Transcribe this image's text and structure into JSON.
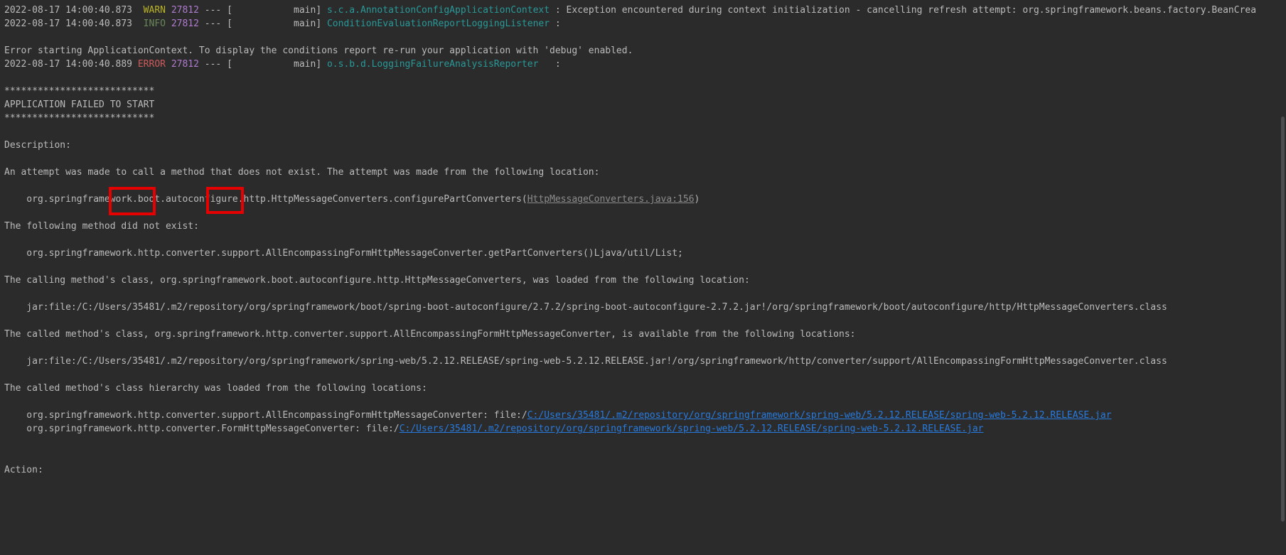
{
  "log_lines": [
    {
      "ts": "2022-08-17 14:00:40.873",
      "level": "WARN",
      "pid": "27812",
      "sep": "--- [           main]",
      "logger": "s.c.a.AnnotationConfigApplicationContext",
      "message": " : Exception encountered during context initialization - cancelling refresh attempt: org.springframework.beans.factory.BeanCrea"
    },
    {
      "ts": "2022-08-17 14:00:40.873",
      "level": "INFO",
      "pid": "27812",
      "sep": "--- [           main]",
      "logger": "ConditionEvaluationReportLoggingListener",
      "message": " :"
    },
    {
      "ts": "2022-08-17 14:00:40.889",
      "level": "ERROR",
      "pid": "27812",
      "sep": "--- [           main]",
      "logger": "o.s.b.d.LoggingFailureAnalysisReporter",
      "message": "   :"
    }
  ],
  "text": {
    "error_starting": "Error starting ApplicationContext. To display the conditions report re-run your application with 'debug' enabled.",
    "stars1": "***************************",
    "failed_title": "APPLICATION FAILED TO START",
    "stars2": "***************************",
    "description": "Description:",
    "attempt": "An attempt was made to call a method that does not exist. The attempt was made from the following location:",
    "location_prefix": "    org.springframework.boot.autoconfigure.http.HttpMessageConverters.configurePartConverters(",
    "location_link": "HttpMessageConverters.java:156",
    "location_suffix": ")",
    "not_exist": "The following method did not exist:",
    "method": "    org.springframework.http.converter.support.AllEncompassingFormHttpMessageConverter.getPartConverters()Ljava/util/List;",
    "calling_class": "The calling method's class, org.springframework.boot.autoconfigure.http.HttpMessageConverters, was loaded from the following location:",
    "calling_jar": "    jar:file:/C:/Users/35481/.m2/repository/org/springframework/boot/spring-boot-autoconfigure/2.7.2/spring-boot-autoconfigure-2.7.2.jar!/org/springframework/boot/autoconfigure/http/HttpMessageConverters.class",
    "called_class": "The called method's class, org.springframework.http.converter.support.AllEncompassingFormHttpMessageConverter, is available from the following locations:",
    "called_jar": "    jar:file:/C:/Users/35481/.m2/repository/org/springframework/spring-web/5.2.12.RELEASE/spring-web-5.2.12.RELEASE.jar!/org/springframework/http/converter/support/AllEncompassingFormHttpMessageConverter.class",
    "hierarchy": "The called method's class hierarchy was loaded from the following locations:",
    "hier1_prefix": "    org.springframework.http.converter.support.AllEncompassingFormHttpMessageConverter: file:/",
    "hier1_link": "C:/Users/35481/.m2/repository/org/springframework/spring-web/5.2.12.RELEASE/spring-web-5.2.12.RELEASE.jar",
    "hier2_prefix": "    org.springframework.http.converter.FormHttpMessageConverter: file:/",
    "hier2_link": "C:/Users/35481/.m2/repository/org/springframework/spring-web/5.2.12.RELEASE/spring-web-5.2.12.RELEASE.jar",
    "action": "Action:"
  },
  "colors": {
    "background": "#2b2b2b",
    "text": "#bbbbbb",
    "warn": "#bbb529",
    "info": "#6a8759",
    "error": "#cc5c5c",
    "pid": "#b07bd0",
    "logger": "#299999",
    "link_blue": "#287bde",
    "highlight_box": "#e60000"
  }
}
